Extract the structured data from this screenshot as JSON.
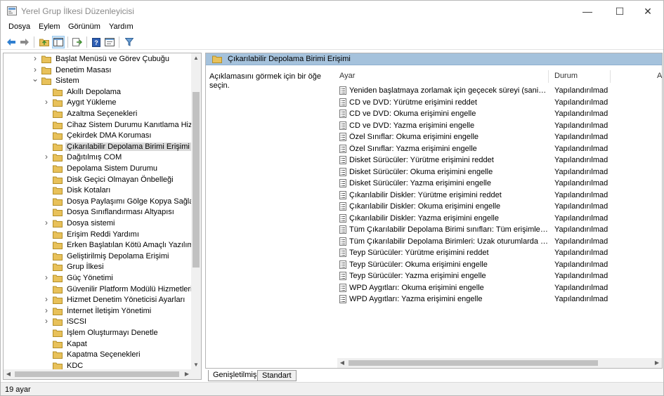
{
  "window": {
    "title": "Yerel Grup İlkesi Düzenleyicisi",
    "controls": {
      "minimize": "—",
      "maximize": "☐",
      "close": "✕"
    }
  },
  "menu": [
    "Dosya",
    "Eylem",
    "Görünüm",
    "Yardım"
  ],
  "tree": {
    "items": [
      {
        "label": "Başlat Menüsü ve Görev Çubuğu",
        "level": 0,
        "expander": "collapsed"
      },
      {
        "label": "Denetim Masası",
        "level": 0,
        "expander": "collapsed"
      },
      {
        "label": "Sistem",
        "level": 0,
        "expander": "expanded"
      },
      {
        "label": "Akıllı Depolama",
        "level": 1,
        "expander": "none"
      },
      {
        "label": "Aygıt Yükleme",
        "level": 1,
        "expander": "collapsed"
      },
      {
        "label": "Azaltma Seçenekleri",
        "level": 1,
        "expander": "none"
      },
      {
        "label": "Cihaz Sistem Durumu Kanıtlama Hizme",
        "level": 1,
        "expander": "none"
      },
      {
        "label": "Çekirdek DMA Koruması",
        "level": 1,
        "expander": "none"
      },
      {
        "label": "Çıkarılabilir Depolama Birimi Erişimi",
        "level": 1,
        "expander": "none",
        "selected": true
      },
      {
        "label": "Dağıtılmış COM",
        "level": 1,
        "expander": "collapsed"
      },
      {
        "label": "Depolama Sistem Durumu",
        "level": 1,
        "expander": "none"
      },
      {
        "label": "Disk Geçici Olmayan Önbelleği",
        "level": 1,
        "expander": "none"
      },
      {
        "label": "Disk Kotaları",
        "level": 1,
        "expander": "none"
      },
      {
        "label": "Dosya Paylaşımı Gölge Kopya Sağlayıcıs",
        "level": 1,
        "expander": "none"
      },
      {
        "label": "Dosya Sınıflandırması Altyapısı",
        "level": 1,
        "expander": "none"
      },
      {
        "label": "Dosya sistemi",
        "level": 1,
        "expander": "collapsed"
      },
      {
        "label": "Erişim Reddi Yardımı",
        "level": 1,
        "expander": "none"
      },
      {
        "label": "Erken Başlatılan Kötü Amaçlı Yazılımdar",
        "level": 1,
        "expander": "none"
      },
      {
        "label": "Geliştirilmiş Depolama Erişimi",
        "level": 1,
        "expander": "none"
      },
      {
        "label": "Grup İlkesi",
        "level": 1,
        "expander": "none"
      },
      {
        "label": "Güç Yönetimi",
        "level": 1,
        "expander": "collapsed"
      },
      {
        "label": "Güvenilir Platform Modülü Hizmetleri",
        "level": 1,
        "expander": "none"
      },
      {
        "label": "Hizmet Denetim Yöneticisi Ayarları",
        "level": 1,
        "expander": "collapsed"
      },
      {
        "label": "İnternet İletişim Yönetimi",
        "level": 1,
        "expander": "collapsed"
      },
      {
        "label": "iSCSI",
        "level": 1,
        "expander": "collapsed"
      },
      {
        "label": "İşlem Oluşturmayı Denetle",
        "level": 1,
        "expander": "none"
      },
      {
        "label": "Kapat",
        "level": 1,
        "expander": "none"
      },
      {
        "label": "Kapatma Seçenekleri",
        "level": 1,
        "expander": "none"
      },
      {
        "label": "KDC",
        "level": 1,
        "expander": "none"
      }
    ]
  },
  "panel": {
    "header_title": "Çıkarılabilir Depolama Birimi Erişimi",
    "description": "Açıklamasını görmek için bir öğe seçin.",
    "columns": {
      "setting": "Ayar",
      "state": "Durum",
      "third": "A"
    },
    "rows": [
      {
        "name": "Yeniden başlatmaya zorlamak için geçecek süreyi (saniye cin...",
        "state": "Yapılandırılmadı"
      },
      {
        "name": "CD ve DVD: Yürütme erişimini reddet",
        "state": "Yapılandırılmadı"
      },
      {
        "name": "CD ve DVD: Okuma erişimini engelle",
        "state": "Yapılandırılmadı"
      },
      {
        "name": "CD ve DVD: Yazma erişimini engelle",
        "state": "Yapılandırılmadı"
      },
      {
        "name": "Özel Sınıflar: Okuma erişimini engelle",
        "state": "Yapılandırılmadı"
      },
      {
        "name": "Özel Sınıflar: Yazma erişimini engelle",
        "state": "Yapılandırılmadı"
      },
      {
        "name": "Disket Sürücüler: Yürütme erişimini reddet",
        "state": "Yapılandırılmadı"
      },
      {
        "name": "Disket Sürücüler: Okuma erişimini engelle",
        "state": "Yapılandırılmadı"
      },
      {
        "name": "Disket Sürücüler: Yazma erişimini engelle",
        "state": "Yapılandırılmadı"
      },
      {
        "name": "Çıkarılabilir Diskler: Yürütme erişimini reddet",
        "state": "Yapılandırılmadı"
      },
      {
        "name": "Çıkarılabilir Diskler: Okuma erişimini engelle",
        "state": "Yapılandırılmadı"
      },
      {
        "name": "Çıkarılabilir Diskler: Yazma erişimini engelle",
        "state": "Yapılandırılmadı"
      },
      {
        "name": "Tüm Çıkarılabilir Depolama Birimi sınıfları: Tüm erişimleri en...",
        "state": "Yapılandırılmadı"
      },
      {
        "name": "Tüm Çıkarılabilir Depolama Birimleri: Uzak oturumlarda doğ...",
        "state": "Yapılandırılmadı"
      },
      {
        "name": "Teyp Sürücüler: Yürütme erişimini reddet",
        "state": "Yapılandırılmadı"
      },
      {
        "name": "Teyp Sürücüler: Okuma erişimini engelle",
        "state": "Yapılandırılmadı"
      },
      {
        "name": "Teyp Sürücüler: Yazma erişimini engelle",
        "state": "Yapılandırılmadı"
      },
      {
        "name": "WPD Aygıtları: Okuma erişimini engelle",
        "state": "Yapılandırılmadı"
      },
      {
        "name": "WPD Aygıtları: Yazma erişimini engelle",
        "state": "Yapılandırılmadı"
      }
    ]
  },
  "tabs": [
    "Genişletilmiş",
    "Standart"
  ],
  "status": "19 ayar",
  "colors": {
    "header_bg": "#a5c2dc",
    "folder": "#e8c15a",
    "selection": "#d9d9d9"
  }
}
